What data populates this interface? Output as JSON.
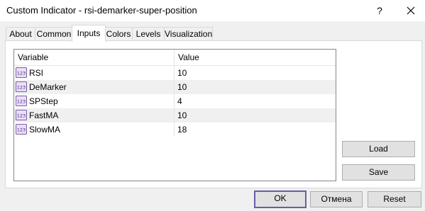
{
  "window": {
    "title": "Custom Indicator - rsi-demarker-super-position",
    "help_label": "?"
  },
  "tabs": [
    {
      "label": "About",
      "active": false
    },
    {
      "label": "Common",
      "active": false
    },
    {
      "label": "Inputs",
      "active": true
    },
    {
      "label": "Colors",
      "active": false
    },
    {
      "label": "Levels",
      "active": false
    },
    {
      "label": "Visualization",
      "active": false
    }
  ],
  "table": {
    "columns": [
      "Variable",
      "Value"
    ],
    "row_icon": "number-variable-icon",
    "rows": [
      {
        "variable": "RSI",
        "value": "10"
      },
      {
        "variable": "DeMarker",
        "value": "10"
      },
      {
        "variable": "SPStep",
        "value": "4"
      },
      {
        "variable": "FastMA",
        "value": "10"
      },
      {
        "variable": "SlowMA",
        "value": "18"
      }
    ]
  },
  "side_buttons": {
    "load": "Load",
    "save": "Save"
  },
  "footer": {
    "ok": "OK",
    "cancel": "Отмена",
    "reset": "Reset"
  },
  "colors": {
    "default_button_border": "#6d5ba4",
    "icon_purple": "#7b5ea7"
  }
}
